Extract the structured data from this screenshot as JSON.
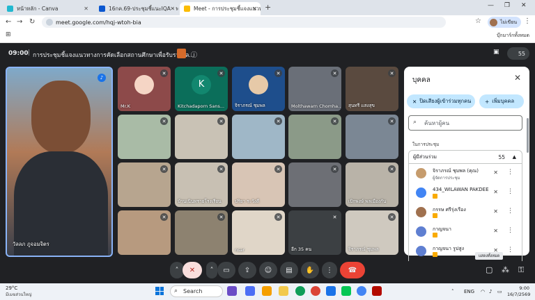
{
  "browser": {
    "tabs": [
      {
        "title": "หน้าหลัก - Canva",
        "color": "#22b8cf"
      },
      {
        "title": "16กค.69-ประชุมชี้แนะIQA - พร้อม...",
        "color": "#0b57d0"
      },
      {
        "title": "Meet - การประชุมชี้แจงแนวทา...",
        "color": "#fbbc04"
      }
    ],
    "url": "meet.google.com/hqj-wtoh-bia",
    "profile_label": "ไม่เขียน",
    "all_bookmarks": "บุ๊กมาร์กทั้งหมด"
  },
  "meeting": {
    "time": "09:00",
    "title": "การประชุมชี้แจงแนวทางการคัดเลือกสถานศึกษาเพื่อรับรางวัล...",
    "people_count": "55"
  },
  "speaker": {
    "name": "วัลลภ ภูจอมจิตร"
  },
  "tiles": [
    {
      "name": "Mr.K",
      "bg": "#8d4a4a",
      "avatar": "",
      "avatar_bg": "#f5d5c5"
    },
    {
      "name": "Kitchadaporn Sans...",
      "bg": "#0b6e5a",
      "avatar": "K",
      "avatar_bg": "#12876f"
    },
    {
      "name": "จิราภรณ์ ชุมพล",
      "bg": "#1e4e8c",
      "avatar": "",
      "avatar_bg": "#e6c9a8"
    },
    {
      "name": "Molthawarn Chomha...",
      "bg": "#6a6f78",
      "avatar": "",
      "avatar_bg": ""
    },
    {
      "name": "สุนทรี แสงสุข",
      "bg": "#5a4a3f",
      "avatar": "",
      "avatar_bg": ""
    },
    {
      "name": "",
      "bg": "#a9bba6",
      "avatar": "",
      "avatar_bg": ""
    },
    {
      "name": "",
      "bg": "#c9c2b5",
      "avatar": "",
      "avatar_bg": ""
    },
    {
      "name": "",
      "bg": "#9fb7c7",
      "avatar": "",
      "avatar_bg": ""
    },
    {
      "name": "",
      "bg": "#8b9a88",
      "avatar": "",
      "avatar_bg": ""
    },
    {
      "name": "",
      "bg": "#7b8794",
      "avatar": "",
      "avatar_bg": ""
    },
    {
      "name": "",
      "bg": "#b7a58f",
      "avatar": "",
      "avatar_bg": ""
    },
    {
      "name": "บ้านเนินทรายโรงเรียน",
      "bg": "#c8c0b3",
      "avatar": "",
      "avatar_bg": ""
    },
    {
      "name": "ปริยา ระวังดี",
      "bg": "#d8c5b5",
      "avatar": "",
      "avatar_bg": ""
    },
    {
      "name": "",
      "bg": "#6d6f75",
      "avatar": "",
      "avatar_bg": ""
    },
    {
      "name": "เบิกพงษ์ พลเมืองกัน",
      "bg": "#b9b3a8",
      "avatar": "",
      "avatar_bg": ""
    },
    {
      "name": "",
      "bg": "#b79a7f",
      "avatar": "",
      "avatar_bg": ""
    },
    {
      "name": "",
      "bg": "#8d8270",
      "avatar": "",
      "avatar_bg": ""
    },
    {
      "name": "nsar",
      "bg": "#e0d6c8",
      "avatar": "",
      "avatar_bg": ""
    },
    {
      "name": "อีก 35 คน",
      "bg": "#3c4043",
      "avatar": "",
      "avatar_bg": ""
    },
    {
      "name": "จิราภรณ์ ชุมพล",
      "bg": "#cfc9bf",
      "avatar": "",
      "avatar_bg": ""
    }
  ],
  "panel": {
    "title": "บุคคล",
    "mute_all": "ปิดเสียงผู้เข้าร่วมทุกคน",
    "add_people": "เพิ่มบุคคล",
    "search_placeholder": "ค้นหาผู้คน",
    "section": "ในการประชุม",
    "group_label": "ผู้มีส่วนร่วม",
    "group_count": "55",
    "people": [
      {
        "name": "จิราภรณ์ ชุมพล (คุณ)",
        "sub": "ผู้จัดการประชุม",
        "color": "#c69c6d"
      },
      {
        "name": "434_WILAWAN PAKDEE",
        "sub": "",
        "color": "#4285f4"
      },
      {
        "name": "กรรษ ศรีรุ่งเรือง",
        "sub": "",
        "color": "#a0714f"
      },
      {
        "name": "กาญจนา",
        "sub": "",
        "color": "#5f7fd1"
      },
      {
        "name": "กาญจนา รูปสูง",
        "sub": "",
        "color": "#5f7fd1"
      }
    ]
  },
  "tooltip": "แสดงทั้งหมด",
  "taskbar": {
    "temp": "29°C",
    "weather": "มีเมฆส่วนใหญ่",
    "search": "Search",
    "lang": "ENG",
    "time": "9:00",
    "date": "16/7/2569"
  }
}
